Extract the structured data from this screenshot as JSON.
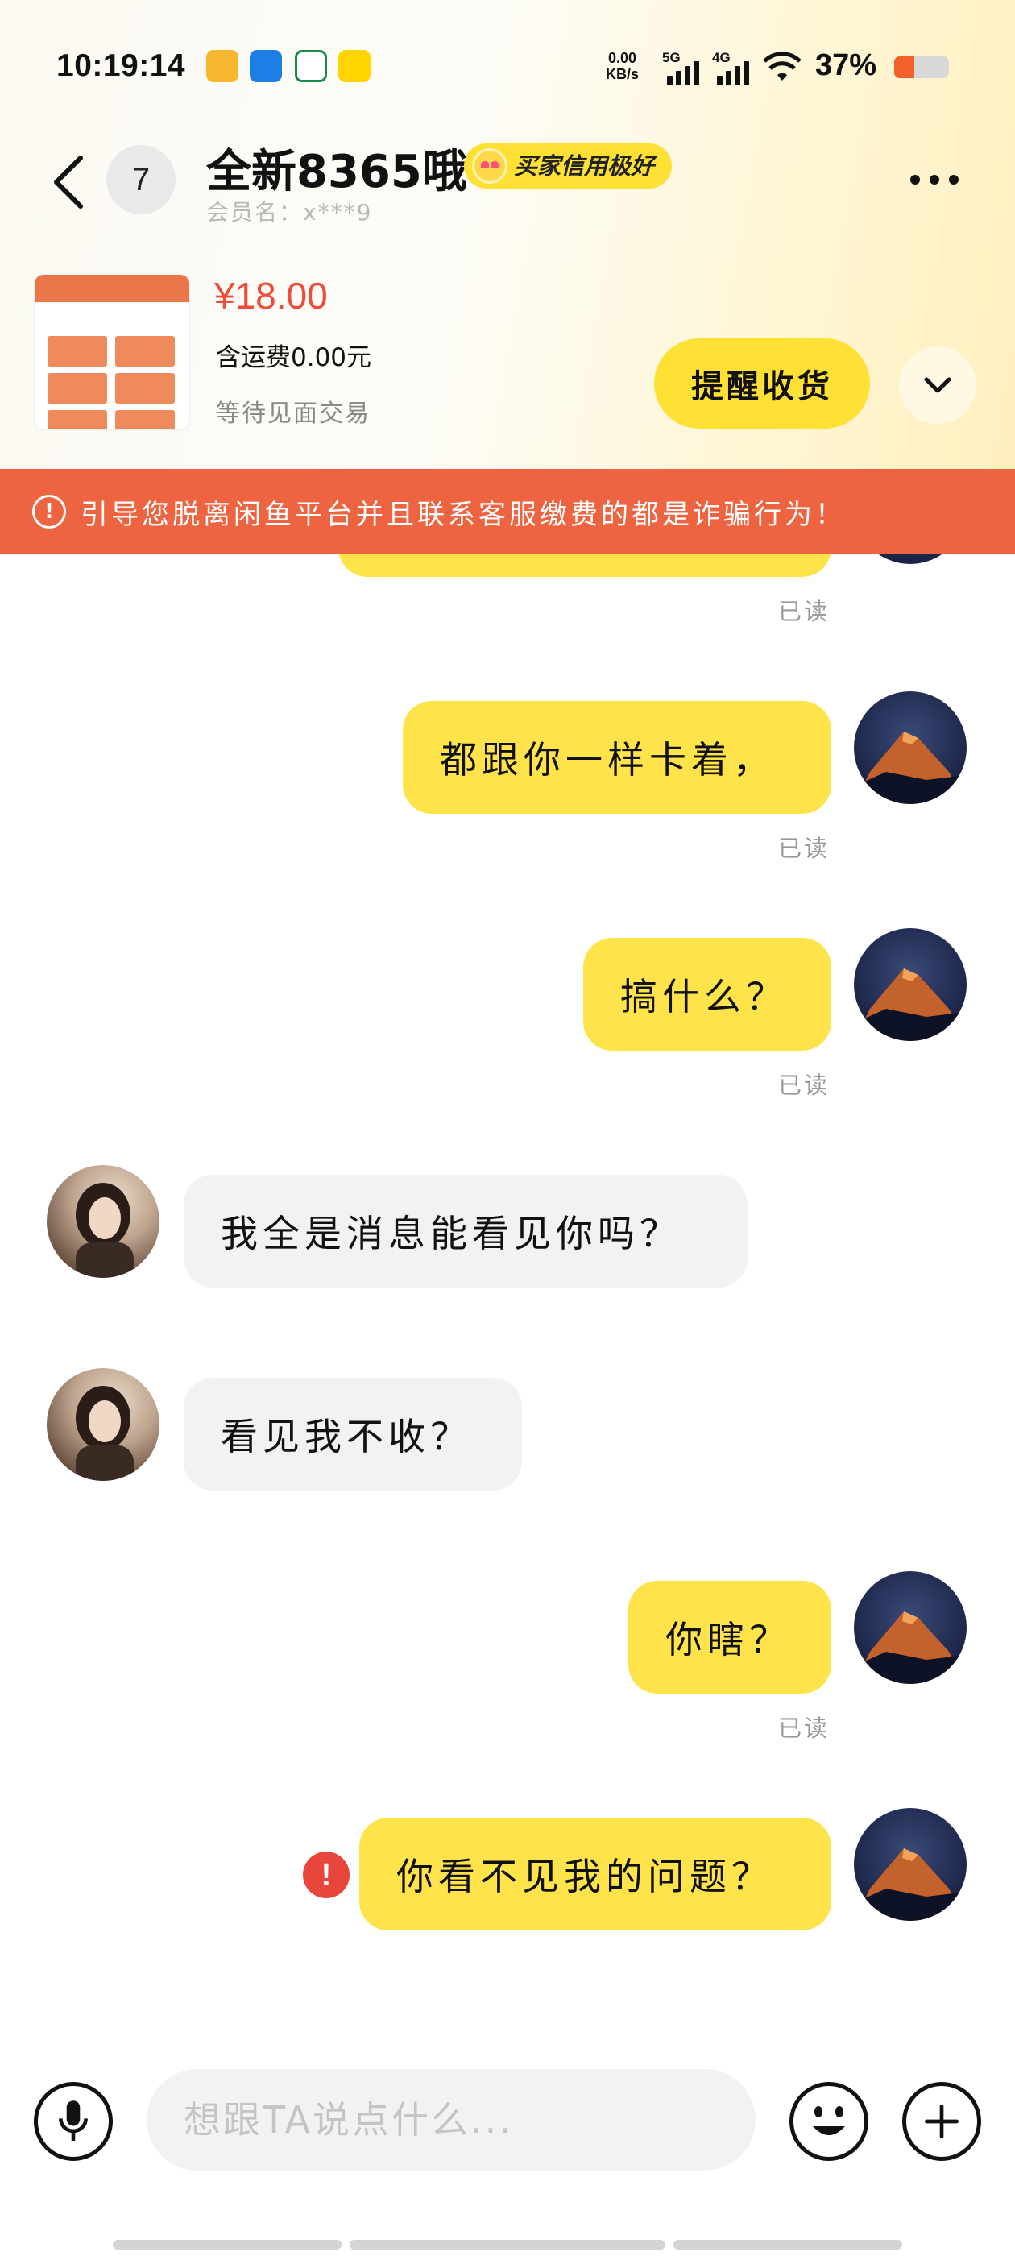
{
  "status_bar": {
    "time": "10:19:14",
    "net_speed_value": "0.00",
    "net_speed_unit": "KB/s",
    "sim1_type": "5G",
    "sim2_type": "4G",
    "battery_percent": "37%",
    "battery_level": 0.37,
    "app_icons": [
      "maps-app-icon",
      "messenger-app-icon",
      "bank-app-icon",
      "meituan-app-icon"
    ],
    "accent_color": "#f0622a"
  },
  "header": {
    "unread_count": "7",
    "contact_name": "全新8365哦",
    "credit_badge": "买家信用极好",
    "member_name": "会员名：x***9"
  },
  "product": {
    "price": "¥18.00",
    "shipping": "含运费0.00元",
    "status": "等待见面交易",
    "action_label": "提醒收货"
  },
  "warning": {
    "text": "引导您脱离闲鱼平台并且联系客服缴费的都是诈骗行为！",
    "color": "#ef6440"
  },
  "messages": [
    {
      "from": "me",
      "text": "都跟你一样卡着，",
      "read": "已读"
    },
    {
      "from": "me",
      "text": "搞什么？",
      "read": "已读"
    },
    {
      "from": "them",
      "text": "我全是消息能看见你吗？"
    },
    {
      "from": "them",
      "text": "看见我不收？"
    },
    {
      "from": "me",
      "text": "你瞎？",
      "read": "已读"
    },
    {
      "from": "me",
      "text": "你看不见我的问题？",
      "failed": true
    }
  ],
  "input": {
    "placeholder": "想跟TA说点什么..."
  },
  "colors": {
    "out_bubble": "#ffe34a",
    "in_bubble": "#f2f2f3",
    "brand_yellow": "#ffe034",
    "price_red": "#ee4b3a"
  }
}
